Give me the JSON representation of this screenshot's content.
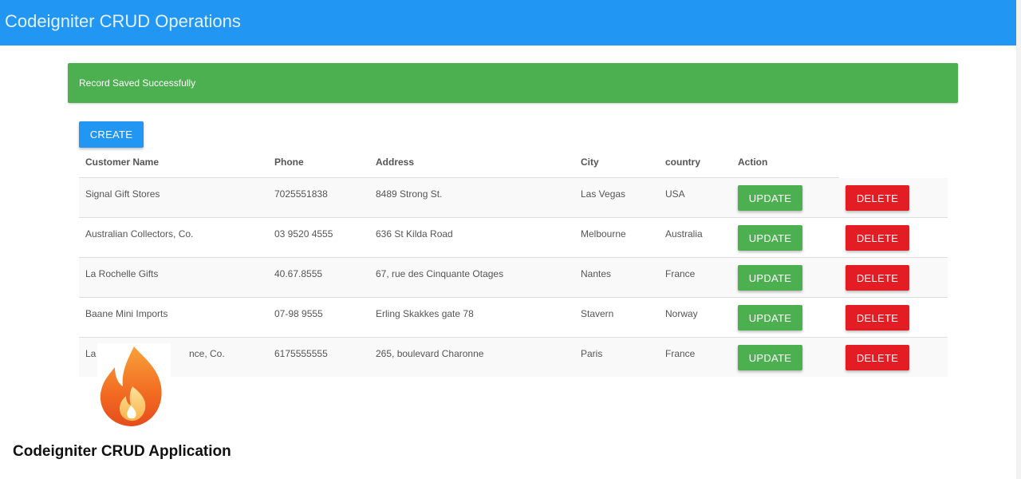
{
  "header": {
    "title": "Codeigniter CRUD Operations"
  },
  "alert": {
    "message": "Record Saved Successfully"
  },
  "toolbar": {
    "create_label": "CREATE"
  },
  "table": {
    "columns": [
      "Customer Name",
      "Phone",
      "Address",
      "City",
      "country",
      "Action"
    ],
    "rows": [
      {
        "name": "Signal Gift Stores",
        "phone": "7025551838",
        "address": "8489 Strong St.",
        "city": "Las Vegas",
        "country": "USA"
      },
      {
        "name": "Australian Collectors, Co.",
        "phone": "03 9520 4555",
        "address": "636 St Kilda Road",
        "city": "Melbourne",
        "country": "Australia"
      },
      {
        "name": "La Rochelle Gifts",
        "phone": "40.67.8555",
        "address": "67, rue des Cinquante Otages",
        "city": "Nantes",
        "country": "France"
      },
      {
        "name": "Baane Mini Imports",
        "phone": "07-98 9555",
        "address": "Erling Skakkes gate 78",
        "city": "Stavern",
        "country": "Norway"
      },
      {
        "name": "La",
        "name_tail": "nce, Co.",
        "phone": "6175555555",
        "address": "265, boulevard Charonne",
        "city": "Paris",
        "country": "France"
      }
    ],
    "update_label": "UPDATE",
    "delete_label": "DELETE"
  },
  "watermark": {
    "caption": "Codeigniter CRUD Application"
  },
  "colors": {
    "navbar": "#2196f3",
    "success": "#4caf50",
    "danger": "#e41c24",
    "logo_flame": "#f26a21"
  }
}
